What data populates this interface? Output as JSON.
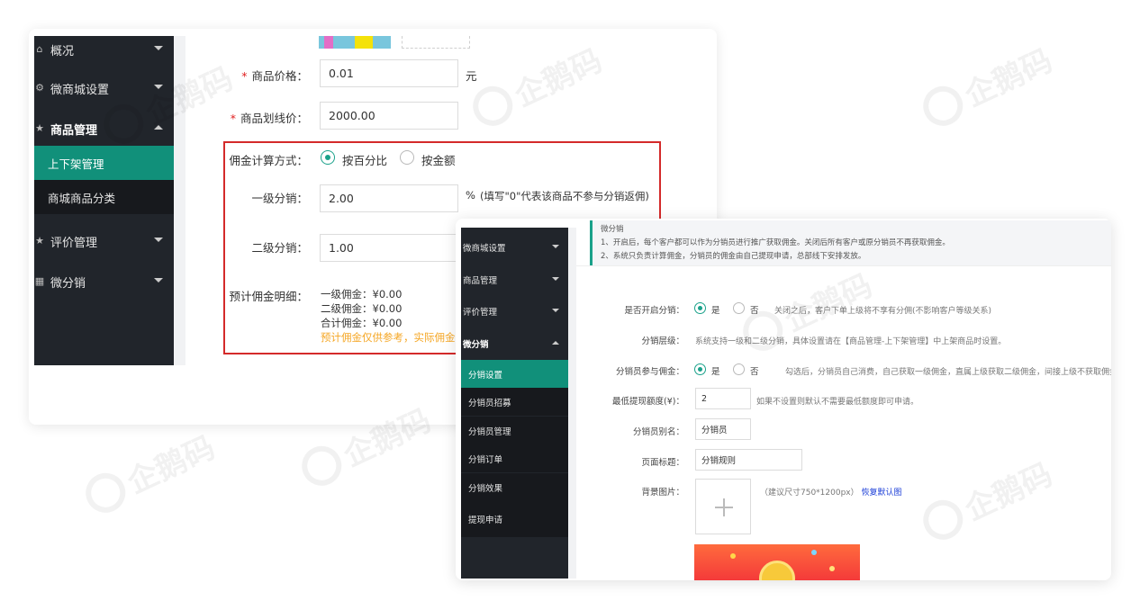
{
  "back_window": {
    "sidebar": {
      "items": [
        {
          "label": "概况",
          "icon": "home-icon",
          "expanded": false
        },
        {
          "label": "微商城设置",
          "icon": "gear-icon",
          "expanded": false
        },
        {
          "label": "商品管理",
          "icon": "star-icon",
          "expanded": true
        },
        {
          "label": "评价管理",
          "icon": "star-icon",
          "expanded": false
        },
        {
          "label": "微分销",
          "icon": "grid-icon",
          "expanded": false
        }
      ],
      "sub_items": [
        {
          "label": "上下架管理",
          "active": true
        },
        {
          "label": "商城商品分类",
          "active": false
        }
      ]
    },
    "form": {
      "price": {
        "label": "商品价格：",
        "value": "0.01",
        "unit": "元"
      },
      "list_price": {
        "label": "商品划线价：",
        "value": "2000.00"
      },
      "commission_method": {
        "label": "佣金计算方式：",
        "options": [
          "按百分比",
          "按金额"
        ],
        "selected": "按百分比"
      },
      "level1": {
        "label": "一级分销：",
        "value": "2.00",
        "suffix": "%",
        "hint": "(填写\"0\"代表该商品不参与分销返佣)"
      },
      "level2": {
        "label": "二级分销：",
        "value": "1.00"
      },
      "estimate": {
        "label": "预计佣金明细：",
        "lines": [
          "一级佣金：¥0.00",
          "二级佣金：¥0.00",
          "合计佣金：¥0.00"
        ],
        "note": "预计佣金仅供参考，实际佣金"
      }
    }
  },
  "front_window": {
    "sidebar": {
      "items": [
        {
          "label": "微商城设置",
          "expanded": false
        },
        {
          "label": "商品管理",
          "expanded": false
        },
        {
          "label": "评价管理",
          "expanded": false
        },
        {
          "label": "微分销",
          "expanded": true
        }
      ],
      "sub_items": [
        {
          "label": "分销设置",
          "active": true
        },
        {
          "label": "分销员招募",
          "active": false
        },
        {
          "label": "分销员管理",
          "active": false
        },
        {
          "label": "分销订单",
          "active": false
        },
        {
          "label": "分销效果",
          "active": false
        },
        {
          "label": "提现申请",
          "active": false
        }
      ]
    },
    "notice": {
      "title": "微分销",
      "lines": [
        "1、开启后，每个客户都可以作为分销员进行推广获取佣金。关闭后所有客户或原分销员不再获取佣金。",
        "2、系统只负责计算佣金，分销员的佣金由自己提现申请，总部线下安排发放。"
      ]
    },
    "form": {
      "enable": {
        "label": "是否开启分销：",
        "options": [
          "是",
          "否"
        ],
        "selected": "是",
        "hint": "关闭之后，客户下单上级将不享有分佣(不影响客户等级关系)"
      },
      "levels": {
        "label": "分销层级：",
        "text": "系统支持一级和二级分销，具体设置请在【商品管理-上下架管理】中上架商品时设置。"
      },
      "self_commission": {
        "label": "分销员参与佣金：",
        "options": [
          "是",
          "否"
        ],
        "selected": "是",
        "hint": "勾选后，分销员自己消费，自己获取一级佣金，直属上级获取二级佣金，间接上级不获取佣金"
      },
      "min_withdraw": {
        "label": "最低提现额度(¥)：",
        "value": "2",
        "hint": "如果不设置则默认不需要最低额度即可申请。"
      },
      "alias": {
        "label": "分销员别名：",
        "value": "分销员"
      },
      "page_title": {
        "label": "页面标题：",
        "value": "分销规则"
      },
      "background": {
        "label": "背景图片：",
        "hint": "（建议尺寸750*1200px）",
        "restore_link": "恢复默认图"
      }
    }
  },
  "watermark": {
    "text": "企鹅码"
  },
  "colors": {
    "accent": "#1aa18a",
    "sidebar": "#21252b",
    "highlight_box": "#d42a2a",
    "warning_text": "#f5a623",
    "link": "#1c3fd8"
  }
}
